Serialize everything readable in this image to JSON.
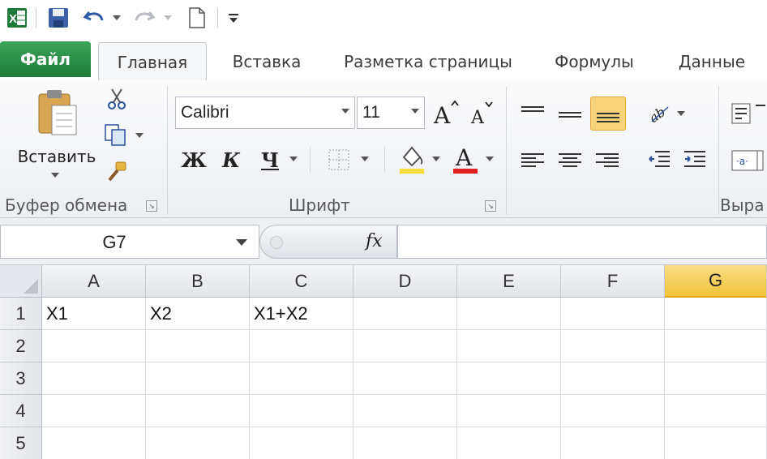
{
  "quick_access": {
    "app_icon": "excel-icon",
    "save_icon": "save-icon",
    "undo_icon": "undo-icon",
    "redo_icon": "redo-icon",
    "new_icon": "new-document-icon",
    "customize_icon": "customize-qat-icon"
  },
  "tabs": {
    "file": "Файл",
    "items": [
      "Главная",
      "Вставка",
      "Разметка страницы",
      "Формулы",
      "Данные"
    ],
    "active": "Главная"
  },
  "ribbon": {
    "clipboard": {
      "paste_label": "Вставить",
      "group_label": "Буфер обмена"
    },
    "font": {
      "font_name": "Calibri",
      "font_size": "11",
      "bold": "Ж",
      "italic": "К",
      "underline": "Ч",
      "group_label": "Шрифт",
      "font_color": "#e02020",
      "fill_color": "#f5e03a"
    },
    "alignment": {
      "group_label": "Выра"
    }
  },
  "formula_bar": {
    "name_box": "G7",
    "fx_label": "fx",
    "formula": ""
  },
  "grid": {
    "columns": [
      "A",
      "B",
      "C",
      "D",
      "E",
      "F",
      "G"
    ],
    "selected_column": "G",
    "rows": [
      "1",
      "2",
      "3",
      "4",
      "5"
    ],
    "cells": [
      [
        "X1",
        "X2",
        "X1+X2",
        "",
        "",
        "",
        ""
      ],
      [
        "",
        "",
        "",
        "",
        "",
        "",
        ""
      ],
      [
        "",
        "",
        "",
        "",
        "",
        "",
        ""
      ],
      [
        "",
        "",
        "",
        "",
        "",
        "",
        ""
      ],
      [
        "",
        "",
        "",
        "",
        "",
        "",
        ""
      ]
    ]
  },
  "colors": {
    "file_tab": "#2a8c46",
    "selection": "#f1c338",
    "accent_highlight": "#f5c542"
  }
}
